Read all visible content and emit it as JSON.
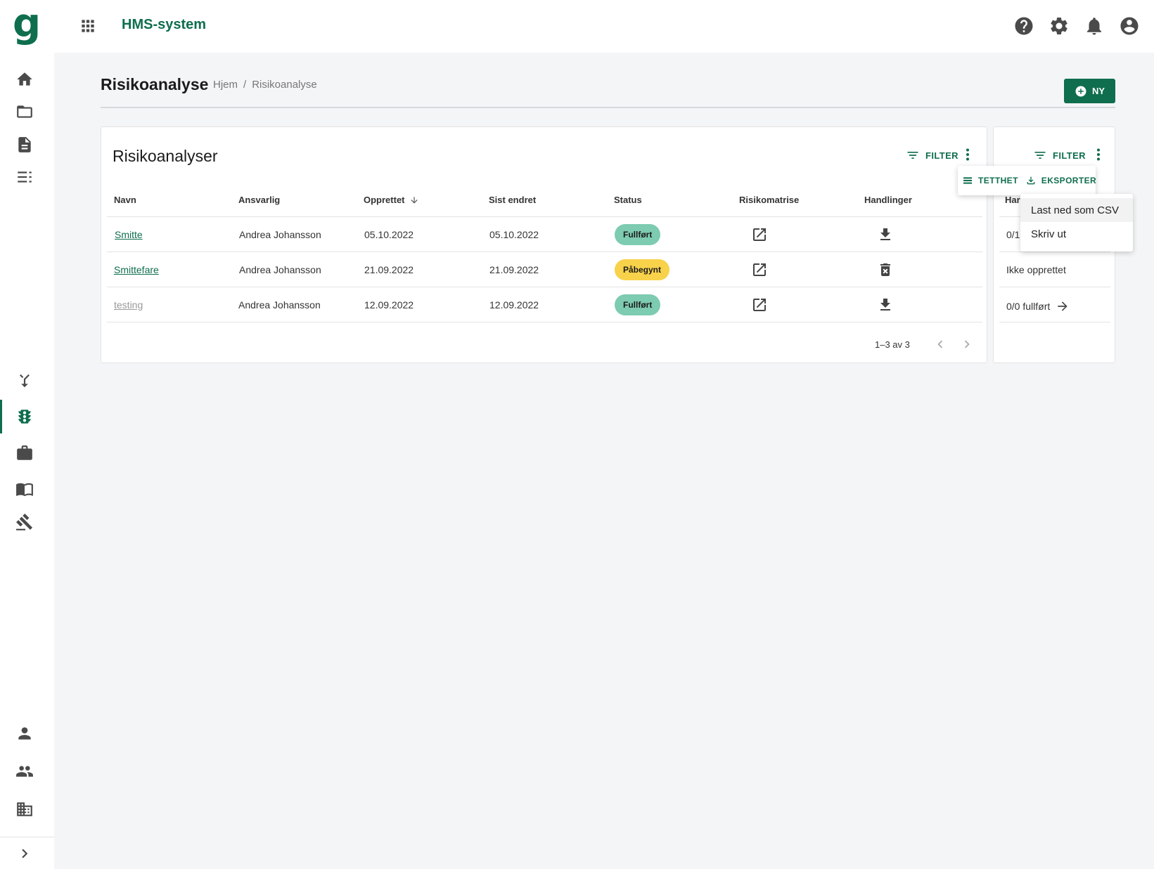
{
  "app": {
    "logo": "g",
    "title": "HMS-system"
  },
  "page": {
    "title": "Risikoanalyse",
    "breadcrumb": [
      "Hjem",
      "Risikoanalyse"
    ],
    "new_button": "NY"
  },
  "table": {
    "title": "Risikoanalyser",
    "filter_label": "FILTER",
    "columns": [
      "Navn",
      "Ansvarlig",
      "Opprettet",
      "Sist endret",
      "Status",
      "Risikomatrise",
      "Handlinger"
    ],
    "sort_column": "Opprettet",
    "rows": [
      {
        "name": "Smitte",
        "owner": "Andrea Johansson",
        "created": "05.10.2022",
        "modified": "05.10.2022",
        "status": "Fullført",
        "status_kind": "done",
        "action_icon": "download-icon"
      },
      {
        "name": "Smittefare",
        "owner": "Andrea Johansson",
        "created": "21.09.2022",
        "modified": "21.09.2022",
        "status": "Påbegynt",
        "status_kind": "started",
        "action_icon": "delete-icon"
      },
      {
        "name": "testing",
        "owner": "Andrea Johansson",
        "created": "12.09.2022",
        "modified": "12.09.2022",
        "status": "Fullført",
        "status_kind": "done",
        "action_icon": "download-icon"
      }
    ],
    "pagination": "1–3 av 3"
  },
  "side_table": {
    "filter_label": "FILTER",
    "column_partial": "Har",
    "rows": [
      {
        "value": "0/1"
      },
      {
        "value": "Ikke opprettet"
      },
      {
        "value": "0/0 fullført"
      }
    ]
  },
  "toolbar_popup": {
    "density": "TETTHET",
    "export": "EKSPORTER"
  },
  "export_menu": {
    "items": [
      "Last ned som CSV",
      "Skriv ut"
    ]
  },
  "colors": {
    "brand": "#0f6e4e",
    "done": "#7dcbb1",
    "started": "#f8d24a"
  }
}
